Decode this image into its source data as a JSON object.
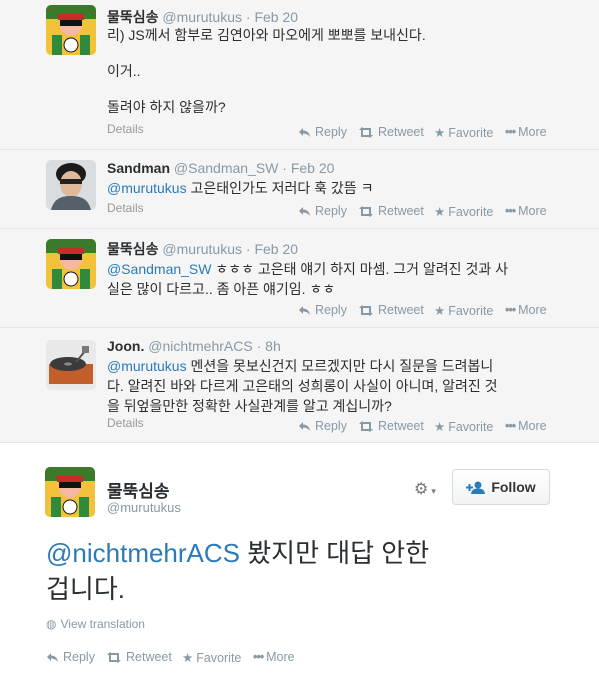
{
  "tweets": [
    {
      "name": "물뚝심송",
      "handle": "@murutukus",
      "sep": "·",
      "time": "Feb 20",
      "lines": [
        {
          "mention": "",
          "text": "리) JS께서 함부로 김연아와 마오에게 뽀뽀를 보내신다."
        },
        {
          "mention": "",
          "text": "이거.."
        },
        {
          "mention": "",
          "text": "돌려야 하지 않을까?"
        }
      ],
      "details": "Details",
      "actions": {
        "reply": "Reply",
        "retweet": "Retweet",
        "favorite": "Favorite",
        "more": "More"
      }
    },
    {
      "name": "Sandman",
      "handle": "@Sandman_SW",
      "sep": "·",
      "time": "Feb 20",
      "lines": [
        {
          "mention": "@murutukus",
          "text": " 고은태인가도 저러다 훅 갔뜸 ㅋ"
        }
      ],
      "details": "Details",
      "actions": {
        "reply": "Reply",
        "retweet": "Retweet",
        "favorite": "Favorite",
        "more": "More"
      }
    },
    {
      "name": "물뚝심송",
      "handle": "@murutukus",
      "sep": "·",
      "time": "Feb 20",
      "lines": [
        {
          "mention": "@Sandman_SW",
          "text": " ㅎㅎㅎ 고은태 얘기 하지 마셈. 그거 알려진 것과 사"
        },
        {
          "mention": "",
          "text": "실은 많이 다르고.. 좀 아픈 얘기임. ㅎㅎ"
        }
      ],
      "details": "",
      "actions": {
        "reply": "Reply",
        "retweet": "Retweet",
        "favorite": "Favorite",
        "more": "More"
      }
    },
    {
      "name": "Joon.",
      "handle": "@nichtmehrACS",
      "sep": "·",
      "time": "8h",
      "lines": [
        {
          "mention": "@murutukus",
          "text": " 멘션을 못보신건지 모르겠지만 다시 질문을 드려봅니"
        },
        {
          "mention": "",
          "text": "다. 알려진 바와 다르게 고은태의 성희롱이 사실이 아니며, 알려진 것"
        },
        {
          "mention": "",
          "text": "을 뒤엎을만한 정확한 사실관계를 알고 계십니까?"
        }
      ],
      "details": "Details",
      "actions": {
        "reply": "Reply",
        "retweet": "Retweet",
        "favorite": "Favorite",
        "more": "More"
      }
    }
  ],
  "main_tweet": {
    "name": "물뚝심송",
    "handle": "@murutukus",
    "follow_label": "Follow",
    "mention": "@nichtmehrACS",
    "text_line1": " 봤지만 대답 안한",
    "text_line2": "겁니다.",
    "view_translation": "View translation",
    "actions": {
      "reply": "Reply",
      "retweet": "Retweet",
      "favorite": "Favorite",
      "more": "More"
    }
  },
  "colors": {
    "link": "#2b7bb9",
    "muted": "#8899a6",
    "background": "#f5f5f5"
  }
}
